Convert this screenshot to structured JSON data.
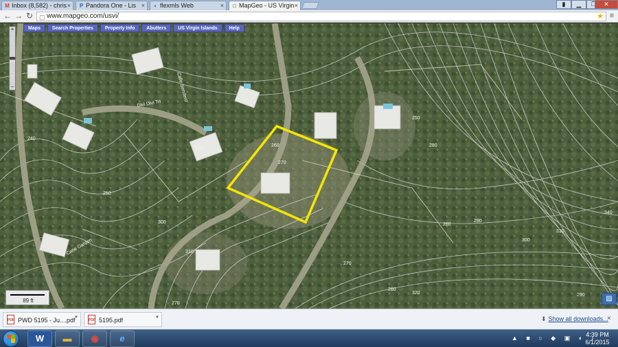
{
  "browser": {
    "tabs": [
      {
        "label": "Inbox (8,582) - chris",
        "favicon": "M",
        "favicon_color": "#d23f31"
      },
      {
        "label": "Pandora One - Lis",
        "favicon": "P",
        "favicon_color": "#2b5fa8"
      },
      {
        "label": "flexmls Web",
        "favicon": "◐",
        "favicon_color": "#3a7fb5"
      },
      {
        "label": "MapGeo - US Virgin",
        "favicon": "□",
        "favicon_color": "#555"
      }
    ],
    "url": "www.mapgeo.com/usvi/",
    "window_controls": [
      "▁",
      "❐",
      "✕"
    ]
  },
  "map": {
    "nav": [
      "Maps",
      "Search Properties",
      "Property Info",
      "Abutters",
      "US Virgin Islands",
      "Help"
    ],
    "zoom": {
      "plus": "+",
      "minus": "−"
    },
    "scale_label": "89 ft",
    "road_labels": [
      "Divi Divi Trl",
      "Calle Sendero",
      "Cane Garden"
    ],
    "contour_labels": [
      "240",
      "250",
      "260",
      "270",
      "280",
      "290",
      "300",
      "310",
      "320",
      "330",
      "340"
    ],
    "parcel_highlight_color": "#f5e600"
  },
  "downloads": {
    "items": [
      {
        "name": "PWD 5195 - Ju....pdf"
      },
      {
        "name": "5195.pdf"
      }
    ],
    "show_all": "Show all downloads...",
    "close": "×"
  },
  "taskbar": {
    "apps": [
      {
        "glyph": "W",
        "color": "#2b579a"
      },
      {
        "glyph": "▬",
        "color": "#e0b440"
      },
      {
        "glyph": "◉",
        "color": "#dd4b39"
      },
      {
        "glyph": "e",
        "color": "#1e88e5"
      }
    ],
    "tray_icons": "▲ ■ ○ ◆ ▣ ◐ ♪",
    "time": "4:39 PM",
    "date": "6/1/2015"
  }
}
